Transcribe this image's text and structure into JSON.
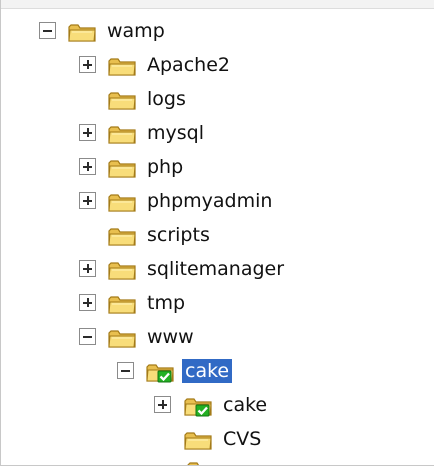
{
  "tree": {
    "nodes": [
      {
        "label": "wamp",
        "toggle": "expanded",
        "icon": "folder-icon"
      },
      {
        "label": "Apache2",
        "toggle": "collapsed",
        "icon": "folder-icon"
      },
      {
        "label": "logs",
        "toggle": "none",
        "icon": "folder-icon"
      },
      {
        "label": "mysql",
        "toggle": "collapsed",
        "icon": "folder-icon"
      },
      {
        "label": "php",
        "toggle": "collapsed",
        "icon": "folder-icon"
      },
      {
        "label": "phpmyadmin",
        "toggle": "collapsed",
        "icon": "folder-icon"
      },
      {
        "label": "scripts",
        "toggle": "none",
        "icon": "folder-icon"
      },
      {
        "label": "sqlitemanager",
        "toggle": "collapsed",
        "icon": "folder-icon"
      },
      {
        "label": "tmp",
        "toggle": "collapsed",
        "icon": "folder-icon"
      },
      {
        "label": "www",
        "toggle": "expanded",
        "icon": "folder-icon"
      },
      {
        "label": "cake",
        "toggle": "expanded",
        "icon": "versioned-folder-icon",
        "selected": true
      },
      {
        "label": "cake",
        "toggle": "collapsed",
        "icon": "versioned-folder-icon"
      },
      {
        "label": "CVS",
        "toggle": "none",
        "icon": "folder-icon"
      }
    ]
  },
  "colors": {
    "selection": "#316ac5",
    "folder": "#f6d86b",
    "checkmark": "#23b023"
  }
}
